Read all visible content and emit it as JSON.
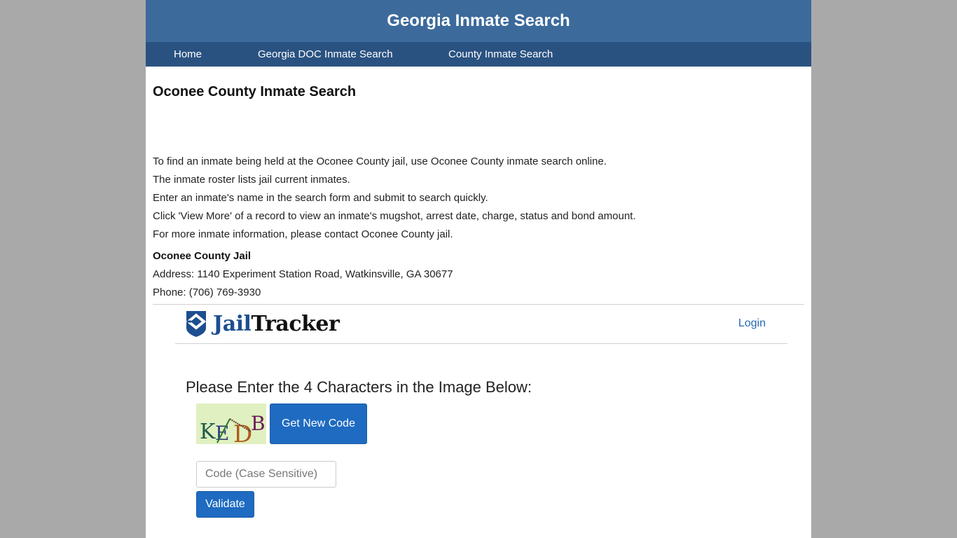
{
  "header": {
    "title": "Georgia Inmate Search"
  },
  "nav": {
    "items": [
      {
        "label": "Home"
      },
      {
        "label": "Georgia DOC Inmate Search"
      },
      {
        "label": "County Inmate Search"
      }
    ]
  },
  "main": {
    "page_title": "Oconee County Inmate Search",
    "intro": [
      "To find an inmate being held at the Oconee County jail, use Oconee County inmate search online.",
      "The inmate roster lists jail current inmates.",
      "Enter an inmate's name in the search form and submit to search quickly.",
      "Click 'View More' of a record to view an inmate's mugshot, arrest date, charge, status and bond amount.",
      "For more inmate information, please contact Oconee County jail."
    ],
    "jail": {
      "name": "Oconee County Jail",
      "address": "Address: 1140 Experiment Station Road, Watkinsville, GA 30677",
      "phone": "Phone: (706) 769-3930"
    }
  },
  "jailtracker": {
    "logo_part1": "Jail",
    "logo_part2": "Tracker",
    "login_label": "Login",
    "captcha_heading": "Please Enter the 4 Characters in the Image Below:",
    "captcha_chars": [
      "K",
      "E",
      "D",
      "B"
    ],
    "get_new_code_label": "Get New Code",
    "code_input_placeholder": "Code (Case Sensitive)",
    "code_input_value": "",
    "validate_label": "Validate"
  },
  "colors": {
    "header_bg": "#3c6a9a",
    "nav_bg": "#2a5281",
    "button_bg": "#1e6bc1",
    "link": "#2a6ab3",
    "logo_blue": "#1d4e8f"
  }
}
